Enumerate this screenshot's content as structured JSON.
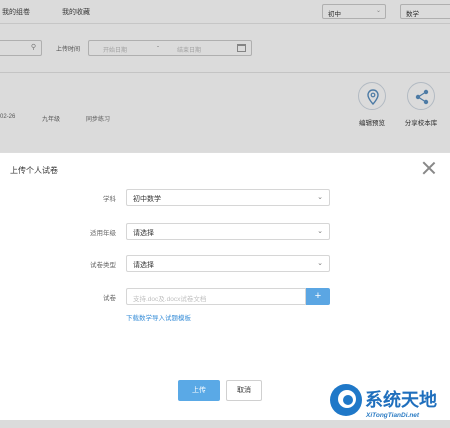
{
  "topnav": {
    "links": [
      "我的组卷",
      "我的收藏"
    ],
    "grade_select": "初中",
    "subject_select": "数学"
  },
  "filter": {
    "upload_time_label": "上传时间",
    "date_start_placeholder": "开始日期",
    "date_sep": "-",
    "date_end_placeholder": "结束日期"
  },
  "paper_meta": {
    "date": "02-26",
    "grade": "九年级",
    "type": "同步练习"
  },
  "actions": {
    "edit_preview": "编辑预览",
    "share": "分享校本库"
  },
  "dialog": {
    "title": "上传个人试卷",
    "subject_label": "学科",
    "subject_value": "初中数学",
    "grade_label": "适用年级",
    "grade_value": "请选择",
    "type_label": "试卷类型",
    "type_value": "请选择",
    "file_label": "试卷",
    "file_placeholder": "支持.doc及.docx试卷文档",
    "plus": "+",
    "template_link": "下载数学导入试题模板",
    "upload_button": "上传",
    "cancel_button": "取消"
  },
  "watermark": {
    "cn": "系统天地",
    "en": "XiTongTianDi.net"
  }
}
